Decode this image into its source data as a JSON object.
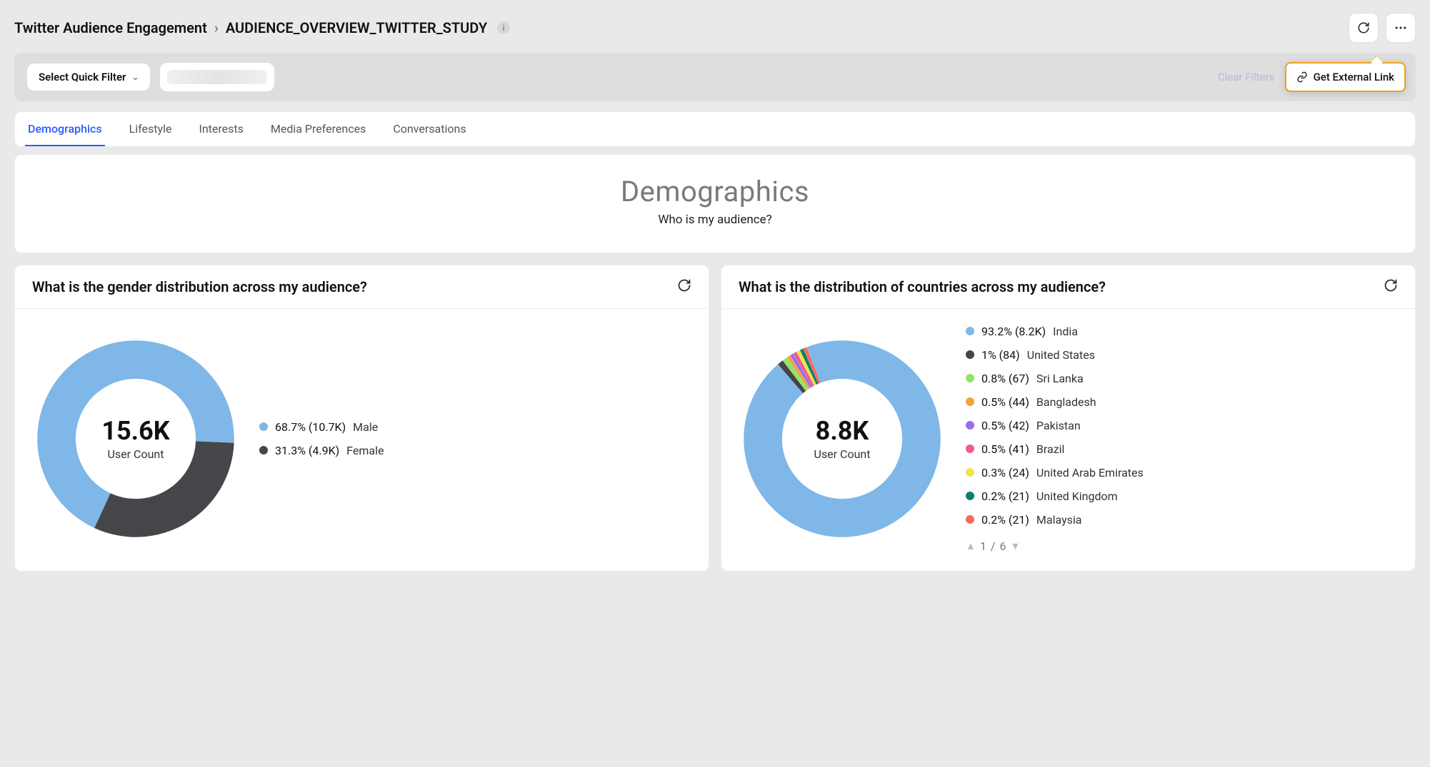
{
  "breadcrumb": {
    "root": "Twitter Audience Engagement",
    "page": "AUDIENCE_OVERVIEW_TWITTER_STUDY"
  },
  "filterBar": {
    "quickFilterLabel": "Select Quick Filter",
    "clearFilters": "Clear Filters",
    "externalLink": "Get External Link"
  },
  "tabs": [
    "Demographics",
    "Lifestyle",
    "Interests",
    "Media Preferences",
    "Conversations"
  ],
  "activeTabIndex": 0,
  "hero": {
    "title": "Demographics",
    "subtitle": "Who is my audience?"
  },
  "genderCard": {
    "title": "What is the gender distribution across my audience?",
    "centerValue": "15.6K",
    "centerLabel": "User Count",
    "legend": [
      {
        "pct": "68.7% (10.7K)",
        "label": "Male",
        "color": "#7EB7E8"
      },
      {
        "pct": "31.3% (4.9K)",
        "label": "Female",
        "color": "#44464A"
      }
    ]
  },
  "countryCard": {
    "title": "What is the distribution of countries across my audience?",
    "centerValue": "8.8K",
    "centerLabel": "User Count",
    "legend": [
      {
        "pct": "93.2% (8.2K)",
        "label": "India",
        "color": "#7EB7E8"
      },
      {
        "pct": "1% (84)",
        "label": "United States",
        "color": "#44464A"
      },
      {
        "pct": "0.8% (67)",
        "label": "Sri Lanka",
        "color": "#8FE56B"
      },
      {
        "pct": "0.5% (44)",
        "label": "Bangladesh",
        "color": "#F5A23C"
      },
      {
        "pct": "0.5% (42)",
        "label": "Pakistan",
        "color": "#9A6EEA"
      },
      {
        "pct": "0.5% (41)",
        "label": "Brazil",
        "color": "#F05B8D"
      },
      {
        "pct": "0.3% (24)",
        "label": "United Arab Emirates",
        "color": "#F2E24B"
      },
      {
        "pct": "0.2% (21)",
        "label": "United Kingdom",
        "color": "#0E7F6E"
      },
      {
        "pct": "0.2% (21)",
        "label": "Malaysia",
        "color": "#F86A5C"
      }
    ],
    "pager": {
      "current": "1",
      "sep": "/",
      "total": "6"
    }
  },
  "chart_data": [
    {
      "type": "pie",
      "title": "What is the gender distribution across my audience?",
      "total_label": "User Count",
      "total_value": 15600,
      "series": [
        {
          "name": "Male",
          "value": 10700,
          "percent": 68.7,
          "color": "#7EB7E8"
        },
        {
          "name": "Female",
          "value": 4900,
          "percent": 31.3,
          "color": "#44464A"
        }
      ]
    },
    {
      "type": "pie",
      "title": "What is the distribution of countries across my audience?",
      "total_label": "User Count",
      "total_value": 8800,
      "series": [
        {
          "name": "India",
          "value": 8200,
          "percent": 93.2,
          "color": "#7EB7E8"
        },
        {
          "name": "United States",
          "value": 84,
          "percent": 1.0,
          "color": "#44464A"
        },
        {
          "name": "Sri Lanka",
          "value": 67,
          "percent": 0.8,
          "color": "#8FE56B"
        },
        {
          "name": "Bangladesh",
          "value": 44,
          "percent": 0.5,
          "color": "#F5A23C"
        },
        {
          "name": "Pakistan",
          "value": 42,
          "percent": 0.5,
          "color": "#9A6EEA"
        },
        {
          "name": "Brazil",
          "value": 41,
          "percent": 0.5,
          "color": "#F05B8D"
        },
        {
          "name": "United Arab Emirates",
          "value": 24,
          "percent": 0.3,
          "color": "#F2E24B"
        },
        {
          "name": "United Kingdom",
          "value": 21,
          "percent": 0.2,
          "color": "#0E7F6E"
        },
        {
          "name": "Malaysia",
          "value": 21,
          "percent": 0.2,
          "color": "#F86A5C"
        }
      ],
      "pagination": {
        "page": 1,
        "total_pages": 6
      }
    }
  ]
}
